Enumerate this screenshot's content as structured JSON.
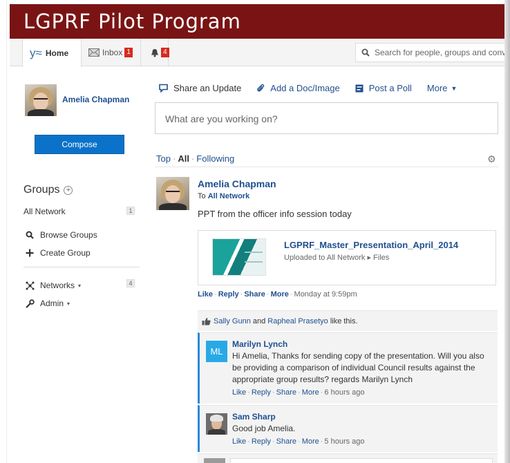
{
  "app": {
    "title": "LGPRF Pilot Program"
  },
  "nav": {
    "home_logo": "y≈",
    "home_label": "Home",
    "inbox_label": "Inbox",
    "inbox_count": "1",
    "notifications_count": "4",
    "search_placeholder": "Search for people, groups and conve"
  },
  "sidebar": {
    "user_name": "Amelia Chapman",
    "compose_label": "Compose",
    "groups_heading": "Groups",
    "groups_add": "+",
    "all_network_label": "All Network",
    "all_network_count": "1",
    "browse_groups_label": "Browse Groups",
    "create_group_label": "Create Group",
    "networks_label": "Networks",
    "networks_count": "4",
    "admin_label": "Admin"
  },
  "publisher": {
    "share_update": "Share an Update",
    "add_doc": "Add a Doc/Image",
    "post_poll": "Post a Poll",
    "more": "More",
    "placeholder": "What are you working on?"
  },
  "feed_filter": {
    "top": "Top",
    "all": "All",
    "following": "Following",
    "separator": "·",
    "gear": "⚙"
  },
  "post": {
    "author": "Amelia Chapman",
    "to_prefix": "To",
    "to_target": "All Network",
    "body": "PPT from the officer info session today",
    "attachment_name": "LGPRF_Master_Presentation_April_2014",
    "attachment_meta": "Uploaded to All Network ▸ Files",
    "like": "Like",
    "reply": "Reply",
    "share": "Share",
    "more": "More",
    "timestamp": "Monday at 9:59pm",
    "likers_1": "Sally Gunn",
    "likers_and": "and",
    "likers_2": "Rapheal Prasetyo",
    "likers_suffix": "like this."
  },
  "replies": [
    {
      "initials": "ML",
      "author": "Marilyn Lynch",
      "text": "Hi Amelia, Thanks for sending copy of the presentation. Will you also be providing a comparison of individual Council results against the appropriate group results? regards Marilyn Lynch",
      "like": "Like",
      "reply": "Reply",
      "share": "Share",
      "more": "More",
      "timestamp": "6 hours ago"
    },
    {
      "author": "Sam Sharp",
      "text": "Good job Amelia.",
      "like": "Like",
      "reply": "Reply",
      "share": "Share",
      "more": "More",
      "timestamp": "5 hours ago"
    }
  ],
  "colors": {
    "brand_bar": "#7a1414",
    "link": "#1f4f8f",
    "compose_button": "#0b72c9",
    "reply_accent": "#2a8ad8",
    "badge": "#d52b1e"
  },
  "icons": {
    "search": "search-icon",
    "inbox": "envelope-icon",
    "notifications": "bell-icon",
    "share_update": "chat-bubble-icon",
    "add_doc": "paperclip-icon",
    "post_poll": "poll-icon",
    "browse_groups": "search-icon",
    "create_group": "plus-icon",
    "networks": "network-icon",
    "admin": "wrench-icon",
    "like": "thumbs-up-icon",
    "settings": "gear-icon"
  }
}
